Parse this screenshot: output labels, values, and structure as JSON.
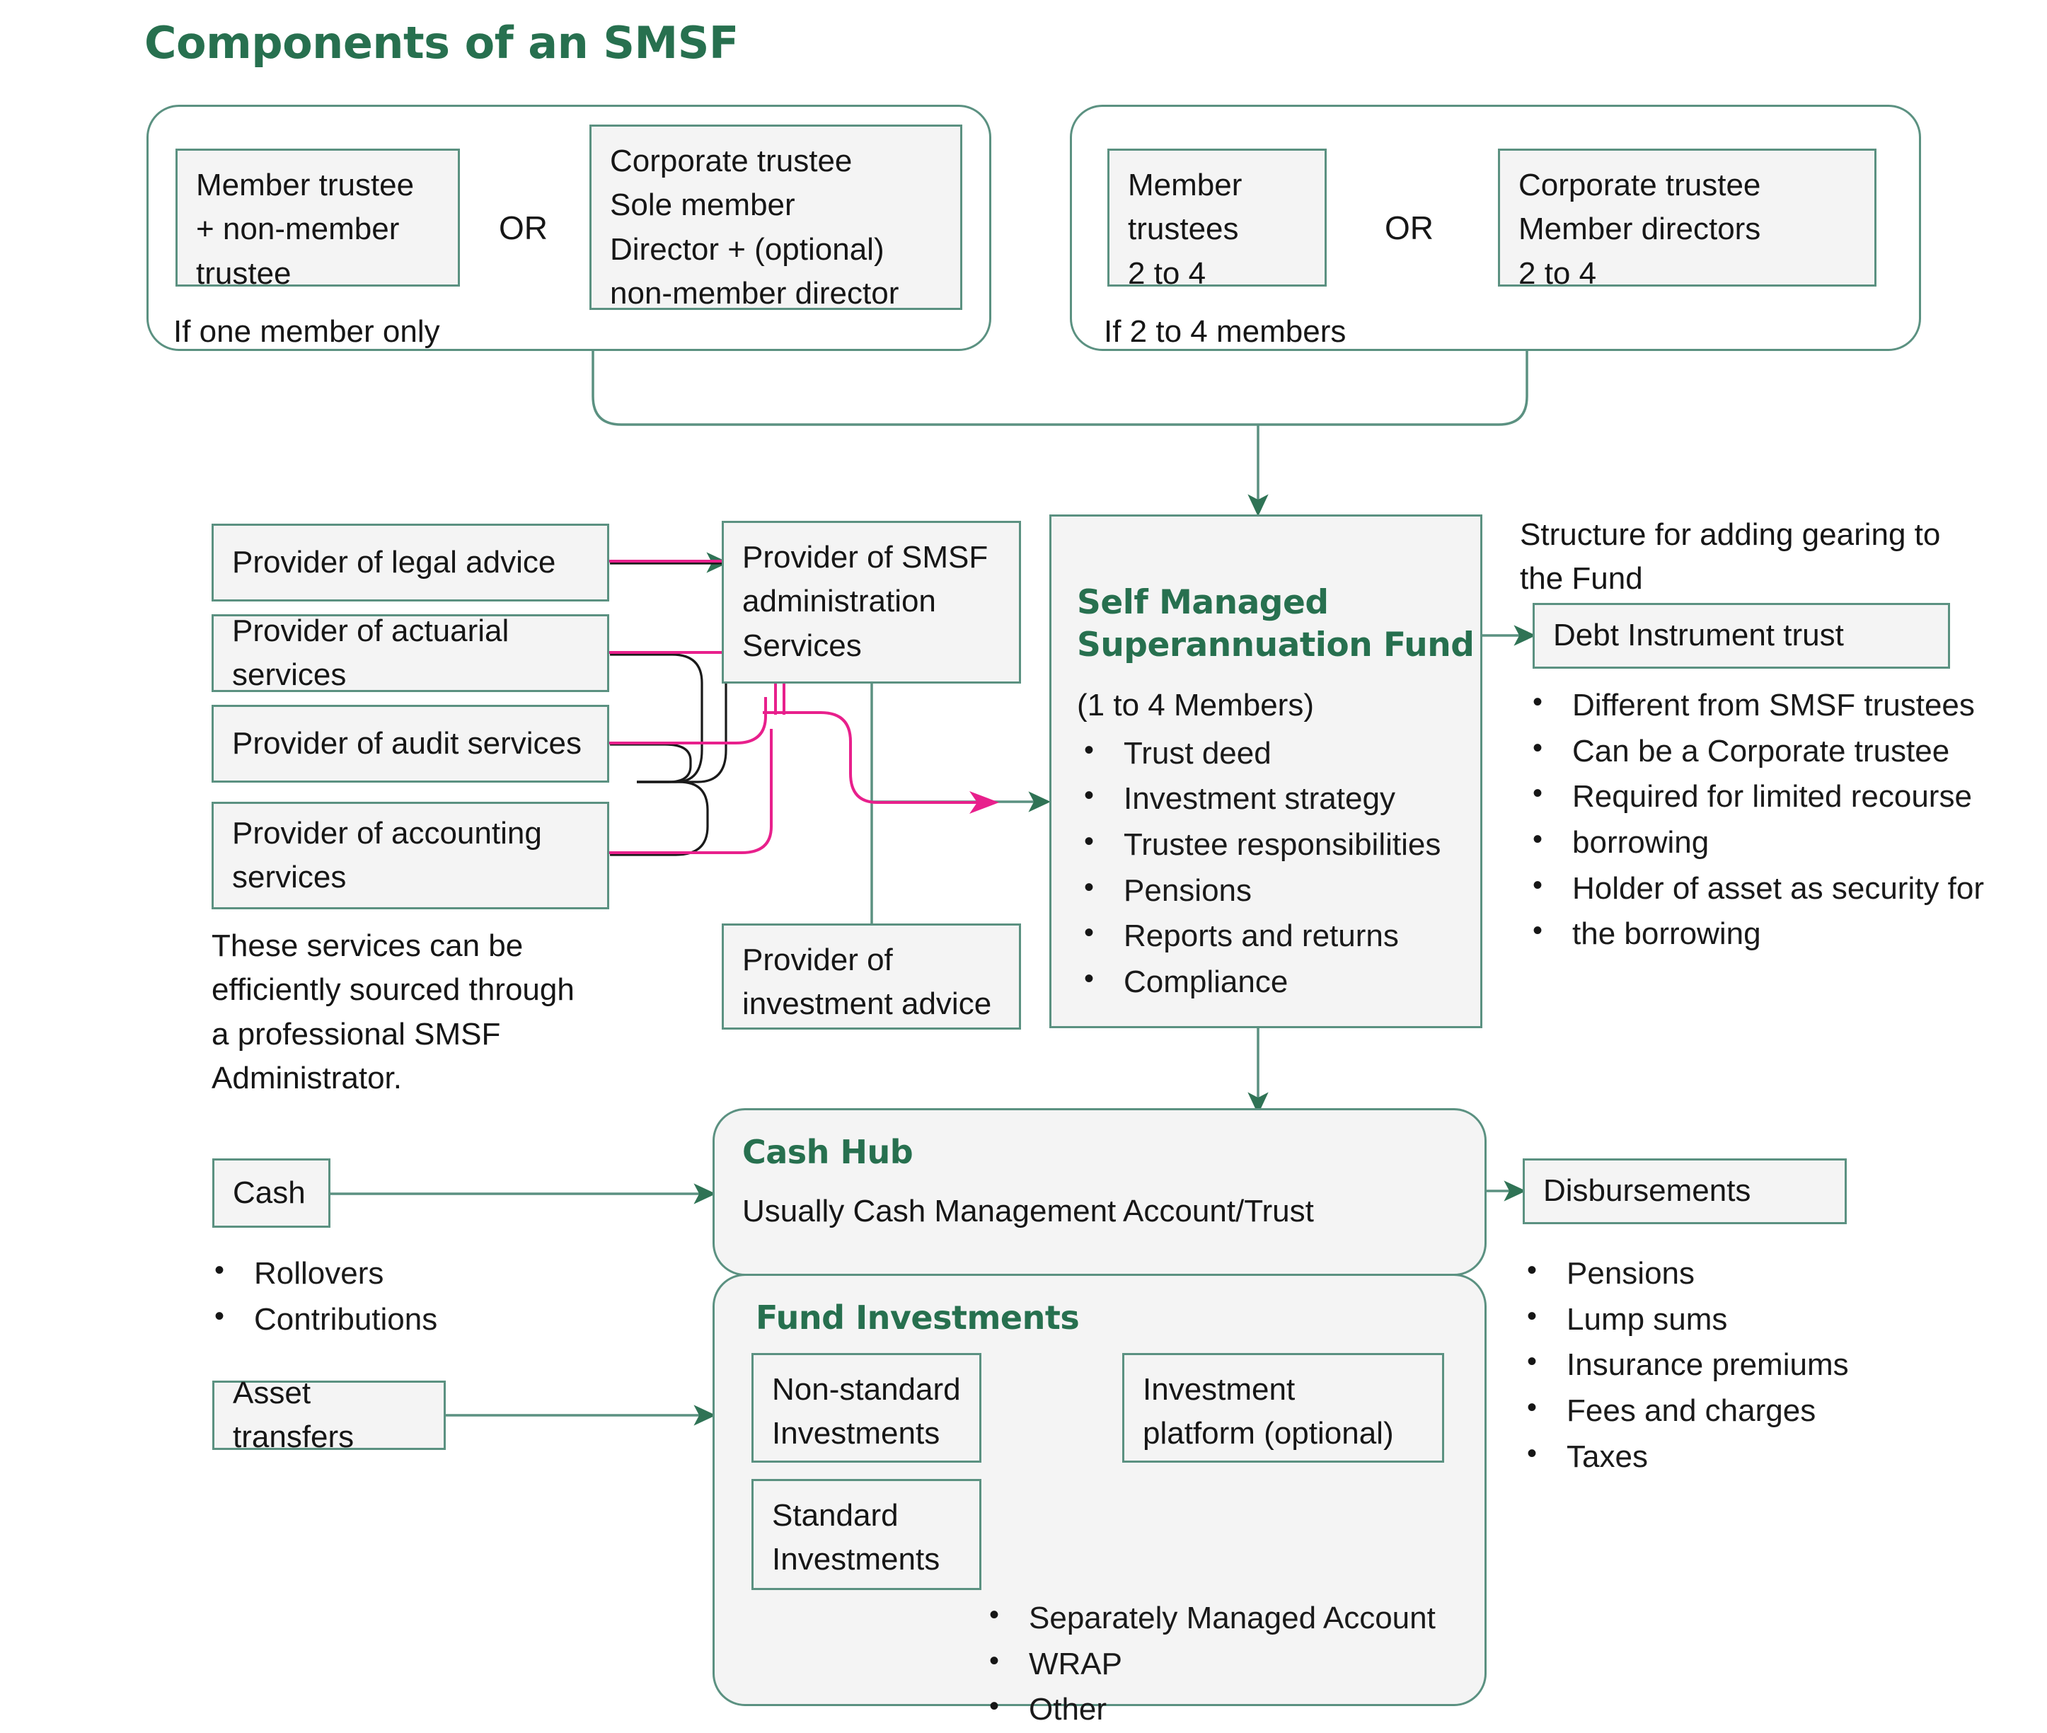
{
  "title": "Components of an SMSF",
  "colors": {
    "accent_green": "#27704f",
    "line_green": "#5b9181",
    "box_fill": "#f4f4f4",
    "magenta": "#e8208c",
    "black_line": "#1a1a1a"
  },
  "trustee_groups": [
    {
      "caption": "If one member only",
      "option_a": "Member trustee\n+ non-member\ntrustee",
      "connector": "OR",
      "option_b": "Corporate trustee\nSole member\nDirector + (optional)\nnon-member director"
    },
    {
      "caption": "If 2 to 4 members",
      "option_a": "Member\ntrustees\n2 to 4",
      "connector": "OR",
      "option_b": "Corporate trustee\nMember directors\n2 to 4"
    }
  ],
  "service_providers": [
    "Provider of legal advice",
    "Provider of actuarial services",
    "Provider of audit services",
    "Provider of accounting services"
  ],
  "providers_note": "These services can be\nefficiently sourced through\na professional SMSF\nAdministrator.",
  "admin_box": "Provider of SMSF\nadministration\nServices",
  "investment_advice_box": "Provider of\ninvestment advice",
  "smsf": {
    "title": "Self Managed\nSuperannuation Fund",
    "subtitle": "(1 to 4 Members)",
    "items": [
      "Trust deed",
      "Investment strategy",
      "Trustee responsibilities",
      "Pensions",
      "Reports and returns",
      "Compliance"
    ]
  },
  "gearing": {
    "note": "Structure for adding gearing to\nthe Fund",
    "box_label": "Debt Instrument trust",
    "items": [
      "Different from SMSF trustees",
      "Can be a Corporate trustee",
      "Required for limited recourse",
      "borrowing",
      "Holder of asset as security for",
      "the borrowing"
    ]
  },
  "cash": {
    "box_label": "Cash",
    "items": [
      "Rollovers",
      "Contributions"
    ]
  },
  "asset_transfers": {
    "box_label": "Asset transfers"
  },
  "cash_hub": {
    "title": "Cash Hub",
    "subtitle": "Usually Cash Management Account/Trust"
  },
  "fund_investments": {
    "title": "Fund Investments",
    "non_standard": "Non-standard\nInvestments",
    "standard": "Standard\nInvestments",
    "platform": "Investment\nplatform (optional)",
    "platform_items": [
      "Separately Managed Account",
      "WRAP",
      "Other"
    ]
  },
  "disbursements": {
    "box_label": "Disbursements",
    "items": [
      "Pensions",
      "Lump sums",
      "Insurance premiums",
      "Fees and charges",
      "Taxes"
    ]
  }
}
